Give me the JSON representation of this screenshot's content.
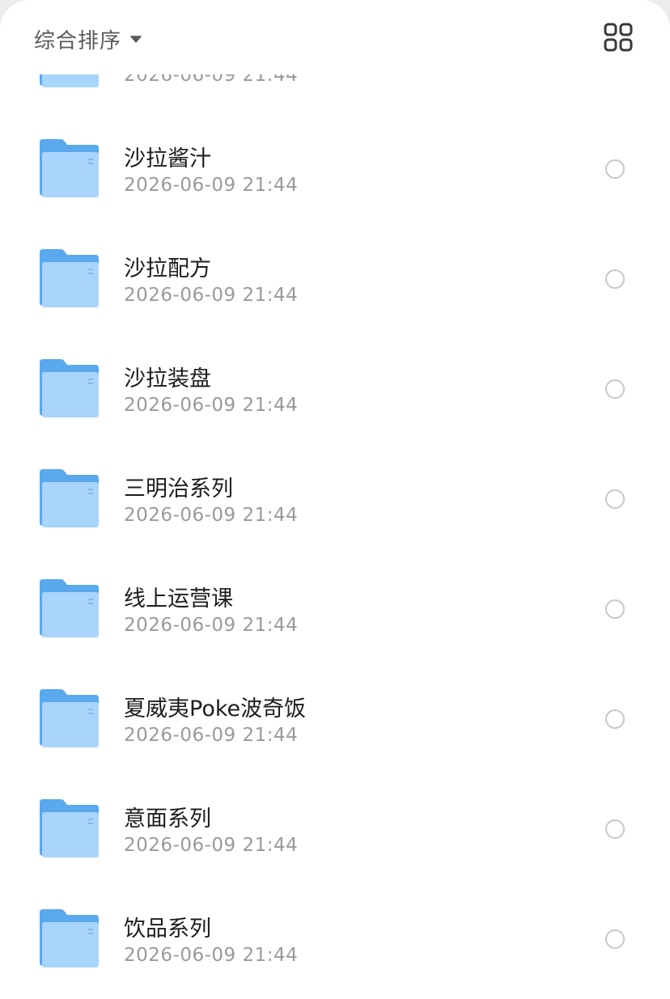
{
  "header": {
    "sort_label": "综合排序",
    "sort_icon": "caret-down-icon",
    "view_toggle_icon": "grid-view-icon"
  },
  "colors": {
    "folder_back": "#5aa9ee",
    "folder_front": "#a9d4fb",
    "text_primary": "#1d1d1d",
    "text_secondary": "#9a9a9a",
    "radio_border": "#c7c7c7"
  },
  "folders": [
    {
      "name": "",
      "date": "2026-06-09 21:44"
    },
    {
      "name": "沙拉酱汁",
      "date": "2026-06-09 21:44"
    },
    {
      "name": "沙拉配方",
      "date": "2026-06-09 21:44"
    },
    {
      "name": "沙拉装盘",
      "date": "2026-06-09 21:44"
    },
    {
      "name": "三明治系列",
      "date": "2026-06-09 21:44"
    },
    {
      "name": "线上运营课",
      "date": "2026-06-09 21:44"
    },
    {
      "name": "夏威夷Poke波奇饭",
      "date": "2026-06-09 21:44"
    },
    {
      "name": "意面系列",
      "date": "2026-06-09 21:44"
    },
    {
      "name": "饮品系列",
      "date": "2026-06-09 21:44"
    }
  ]
}
